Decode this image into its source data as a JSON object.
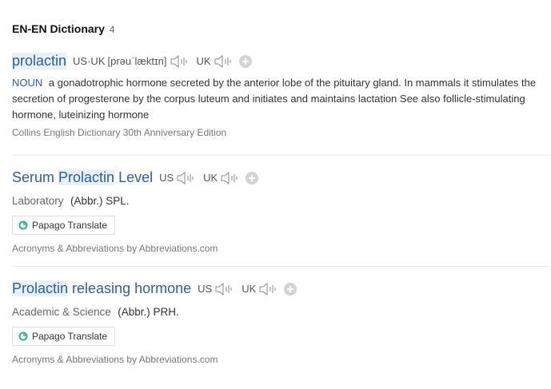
{
  "header": {
    "title": "EN-EN Dictionary",
    "count": "4"
  },
  "entry1": {
    "headword": "prolactin",
    "pron_label": "US·UK",
    "pron": "[prəuˈlæktɪn]",
    "uk_label": "UK",
    "pos": "NOUN",
    "definition": "a gonadotrophic hormone secreted by the anterior lobe of the pituitary gland. In mammals it stimulates the secretion of progesterone by the corpus luteum and initiates and maintains lactation See also follicle-stimulating hormone, luteinizing hormone",
    "source": "Collins English Dictionary 30th Anniversary Edition"
  },
  "entry2": {
    "headword_pre": "Serum ",
    "headword_hl": "Prolactin",
    "headword_post": " Level",
    "us_label": "US",
    "uk_label": "UK",
    "category": "Laboratory",
    "abbr": "(Abbr.) SPL.",
    "translate_label": "Papago Translate",
    "source": "Acronyms & Abbreviations by Abbreviations.com"
  },
  "entry3": {
    "headword_hl": "Prolactin",
    "headword_post": " releasing hormone",
    "us_label": "US",
    "uk_label": "UK",
    "category": "Academic & Science",
    "abbr": "(Abbr.) PRH.",
    "translate_label": "Papago Translate",
    "source": "Acronyms & Abbreviations by Abbreviations.com"
  },
  "icons": [
    "speaker-icon",
    "add-icon",
    "papago-icon"
  ],
  "colors": {
    "link": "#2b5fa8",
    "highlight": "#e8f1fb",
    "papago_teal": "#1fb5a7",
    "papago_orange": "#f5a623"
  }
}
